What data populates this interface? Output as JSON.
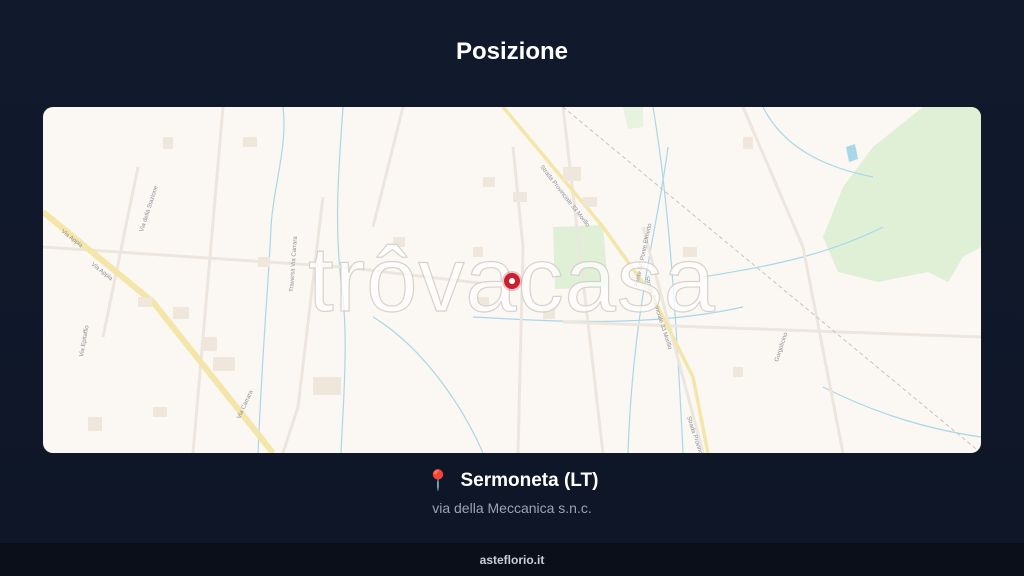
{
  "header": {
    "title": "Posizione"
  },
  "map": {
    "watermark": "trôvacasa",
    "streets": {
      "via_appia_1": "Via Appia",
      "via_appia_2": "Via Appia",
      "via_della_stazione": "Via della Stazione",
      "via_epitaffio": "Via Epitaffio",
      "traversa_via_carrara": "Traversa Via Carrara",
      "via_carrara": "Via Carrara",
      "strada_provinciale_1": "Strada Provinciale 33 Morillo",
      "ponte_sp_ponte_elmetto": "Ponte SP Ponte Elmetto",
      "strada_provinciale_2": "Strada Provinciale 33 Morillo",
      "strada_provinciale_3": "Strada Provinciale",
      "gorgolicino": "Gorgolicino"
    },
    "colors": {
      "background": "#fbf7f3",
      "water": "#a8d8e8",
      "park": "#dff0d6",
      "main_road": "#f4e6a8",
      "pin": "#c8202f"
    }
  },
  "location": {
    "icon": "map-pin-icon",
    "name": "Sermoneta (LT)",
    "address": "via della Meccanica s.n.c."
  },
  "footer": {
    "brand": "asteflorio.it"
  }
}
